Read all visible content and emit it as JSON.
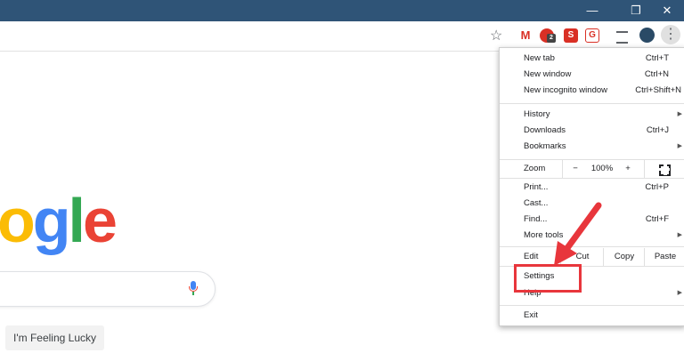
{
  "window": {
    "minimize": "—",
    "restore": "❐",
    "close": "✕"
  },
  "toolbar": {
    "bookmark_star": "☆",
    "ext_gmail": "M",
    "ext_badge": "2",
    "ext_s": "S",
    "ext_red": "G",
    "menu_dots": "⋮"
  },
  "logo_letters": [
    {
      "ch": "o",
      "color": "#fbbc05"
    },
    {
      "ch": "g",
      "color": "#4285f4"
    },
    {
      "ch": "l",
      "color": "#34a853"
    },
    {
      "ch": "e",
      "color": "#ea4335"
    }
  ],
  "lucky_button": "I'm Feeling Lucky",
  "menu": {
    "new_tab": "New tab",
    "new_tab_sc": "Ctrl+T",
    "new_window": "New window",
    "new_window_sc": "Ctrl+N",
    "incognito": "New incognito window",
    "incognito_sc": "Ctrl+Shift+N",
    "history": "History",
    "downloads": "Downloads",
    "downloads_sc": "Ctrl+J",
    "bookmarks": "Bookmarks",
    "zoom": "Zoom",
    "zoom_minus": "−",
    "zoom_value": "100%",
    "zoom_plus": "+",
    "print": "Print...",
    "print_sc": "Ctrl+P",
    "cast": "Cast...",
    "find": "Find...",
    "find_sc": "Ctrl+F",
    "more_tools": "More tools",
    "edit": "Edit",
    "cut": "Cut",
    "copy": "Copy",
    "paste": "Paste",
    "settings": "Settings",
    "help": "Help",
    "exit": "Exit"
  },
  "colors": {
    "titlebar": "#2f5477",
    "highlight": "#e8363c",
    "arrow": "#e8363c"
  }
}
